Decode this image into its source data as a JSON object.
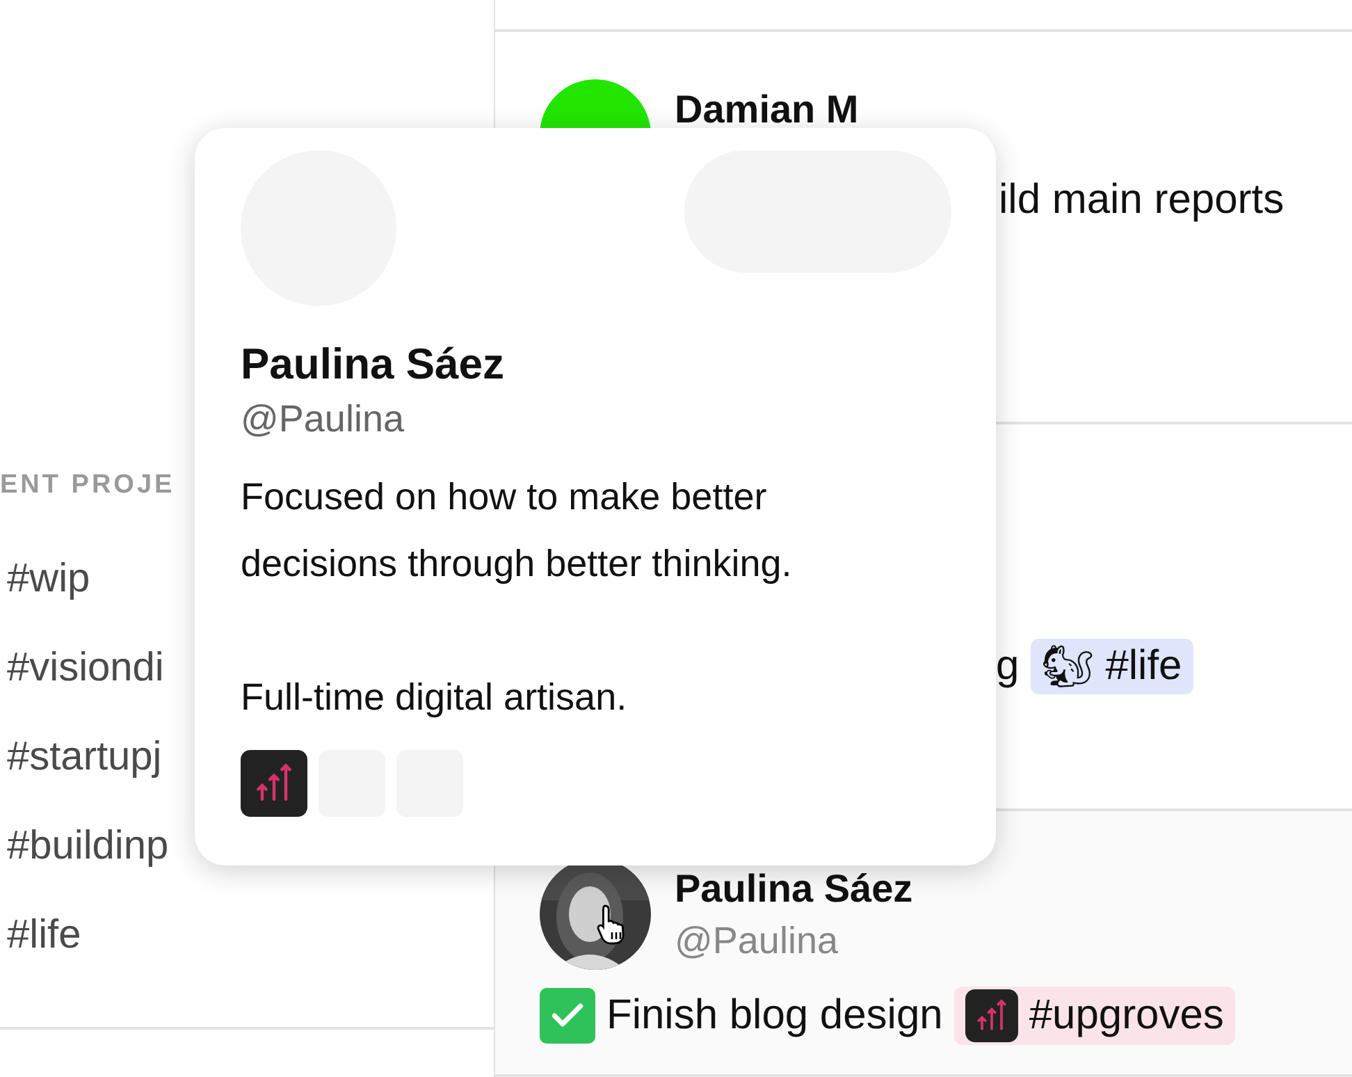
{
  "sidebar": {
    "heading": "ENT PROJE",
    "items": [
      {
        "label": "#wip"
      },
      {
        "label": "#visiondi"
      },
      {
        "label": "#startupj"
      },
      {
        "label": "#buildinp"
      },
      {
        "label": "#life"
      }
    ]
  },
  "feed": {
    "posts": [
      {
        "author": "Damian M",
        "avatar": {
          "color": "#22e600"
        },
        "lines": [
          {
            "text": "ild main reports"
          }
        ]
      },
      {
        "lines": [
          {
            "text": "g",
            "tag": {
              "emoji": "🐿",
              "label": "#life",
              "color": "#dfe5fb"
            }
          }
        ]
      },
      {
        "author": "Paulina Sáez",
        "handle": "@Paulina",
        "avatar": {
          "kind": "picture"
        },
        "tasks": [
          {
            "checked": true,
            "text": "Finish blog design",
            "tag": {
              "label": "#upgroves",
              "color": "#fbe4e9"
            }
          }
        ]
      }
    ]
  },
  "popup": {
    "name": "Paulina Sáez",
    "handle": "@Paulina",
    "bio": [
      "Focused on how to make better decisions through better thinking.",
      "Full-time digital artisan."
    ],
    "projects": [
      {
        "kind": "app"
      },
      {
        "kind": "placeholder"
      },
      {
        "kind": "placeholder"
      }
    ]
  }
}
